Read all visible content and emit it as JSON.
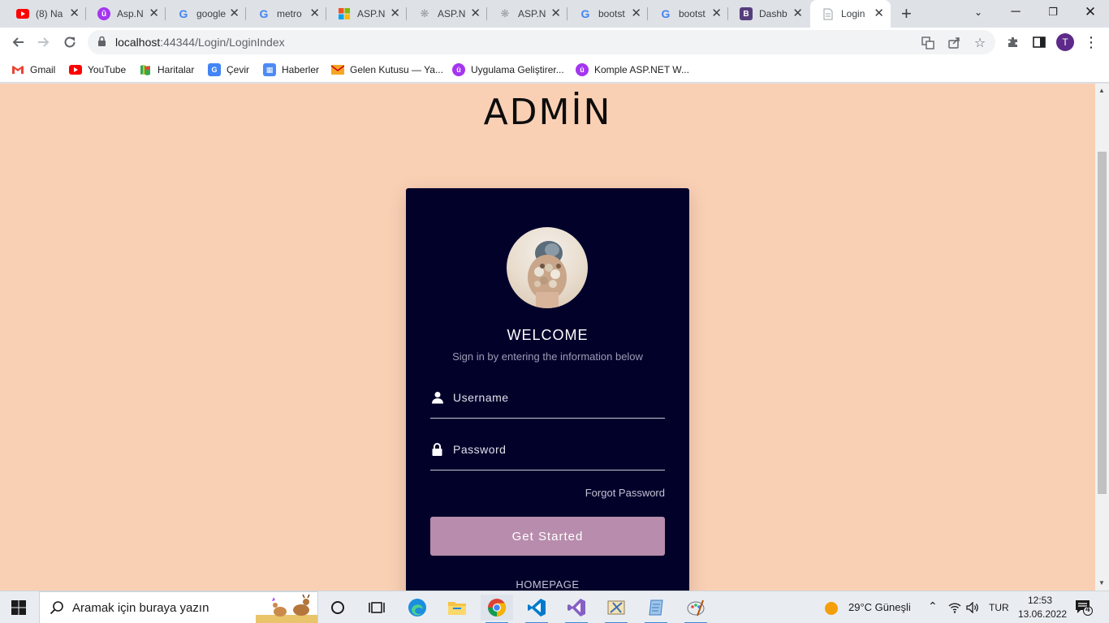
{
  "browser": {
    "tabs": [
      {
        "title": "(8) Na",
        "icon": "youtube-icon"
      },
      {
        "title": "Asp.N",
        "icon": "udemy-icon"
      },
      {
        "title": "google",
        "icon": "google-icon"
      },
      {
        "title": "metro",
        "icon": "google-icon"
      },
      {
        "title": "ASP.N",
        "icon": "microsoft-icon"
      },
      {
        "title": "ASP.N",
        "icon": "page-icon"
      },
      {
        "title": "ASP.N",
        "icon": "page-icon"
      },
      {
        "title": "bootst",
        "icon": "google-icon"
      },
      {
        "title": "bootst",
        "icon": "google-icon"
      },
      {
        "title": "Dashb",
        "icon": "bootstrap-icon"
      },
      {
        "title": "Login",
        "icon": "document-icon"
      }
    ],
    "address": {
      "host": "localhost",
      "rest": ":44344/Login/LoginIndex"
    },
    "profile_initial": "T",
    "bookmarks": [
      {
        "label": "Gmail",
        "icon": "gmail-icon"
      },
      {
        "label": "YouTube",
        "icon": "youtube-icon"
      },
      {
        "label": "Haritalar",
        "icon": "maps-icon"
      },
      {
        "label": "Çevir",
        "icon": "translate-icon"
      },
      {
        "label": "Haberler",
        "icon": "news-icon"
      },
      {
        "label": "Gelen Kutusu — Ya...",
        "icon": "mail-icon"
      },
      {
        "label": "Uygulama Geliştirer...",
        "icon": "udemy-icon"
      },
      {
        "label": "Komple ASP.NET W...",
        "icon": "udemy-icon"
      }
    ]
  },
  "page": {
    "heading": "ADMİN",
    "card": {
      "welcome": "WELCOME",
      "subtitle": "Sign in by entering the information below",
      "username_placeholder": "Username",
      "password_placeholder": "Password",
      "forgot": "Forgot Password",
      "submit": "Get Started",
      "homepage": "HOMEPAGE"
    }
  },
  "taskbar": {
    "search_placeholder": "Aramak için buraya yazın",
    "weather": "29°C  Güneşli",
    "language": "TUR",
    "time": "12:53",
    "date": "13.06.2022",
    "notifications": "4"
  },
  "colors": {
    "page_bg": "#fad0b5",
    "card_bg": "#02012a",
    "button_bg": "#b78cac"
  }
}
